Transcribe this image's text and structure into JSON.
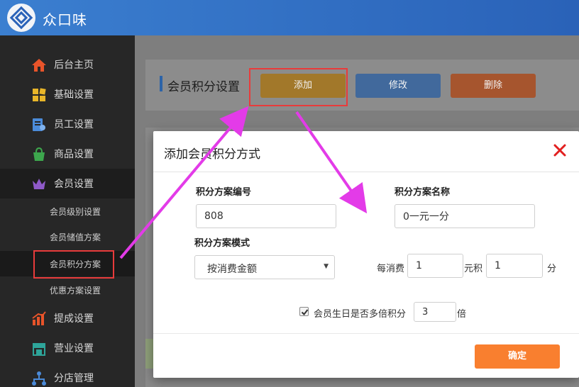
{
  "app": {
    "brand": "众口味"
  },
  "sidebar": {
    "items": [
      {
        "label": "后台主页",
        "icon": "home-icon",
        "color": "#e8542a"
      },
      {
        "label": "基础设置",
        "icon": "grid-icon",
        "color": "#e9b629"
      },
      {
        "label": "员工设置",
        "icon": "staff-icon",
        "color": "#4b8bd9"
      },
      {
        "label": "商品设置",
        "icon": "bag-icon",
        "color": "#3da64d"
      },
      {
        "label": "会员设置",
        "icon": "crown-icon",
        "color": "#8f5ac9"
      }
    ],
    "sub_items": [
      {
        "label": "会员级别设置"
      },
      {
        "label": "会员储值方案"
      },
      {
        "label": "会员积分方案"
      },
      {
        "label": "优惠方案设置"
      }
    ],
    "bottom_items": [
      {
        "label": "提成设置",
        "icon": "chart-icon",
        "color": "#e8542a"
      },
      {
        "label": "营业设置",
        "icon": "store-icon",
        "color": "#2ea59a"
      },
      {
        "label": "分店管理",
        "icon": "branch-icon",
        "color": "#4b8bd9"
      }
    ]
  },
  "page": {
    "title": "会员积分设置",
    "buttons": {
      "add": "添加",
      "edit": "修改",
      "delete": "删除"
    }
  },
  "modal": {
    "title": "添加会员积分方式",
    "scheme_no_label": "积分方案编号",
    "scheme_no_value": "808",
    "scheme_name_label": "积分方案名称",
    "scheme_name_value": "0一元一分",
    "mode_label": "积分方案模式",
    "mode_value": "按消费金额",
    "per_spend_label": "每消费",
    "per_spend_value": "1",
    "yuan_label": "元积",
    "points_value": "1",
    "points_unit": "分",
    "birthday_label": "会员生日是否多倍积分",
    "birthday_checked": true,
    "multiplier_value": "3",
    "multiplier_unit": "倍",
    "confirm_label": "确定"
  },
  "colors": {
    "accent_blue": "#2a62b8",
    "confirm_orange": "#f97f2f",
    "highlight_red": "#e83b3b",
    "arrow_magenta": "#e33be8"
  }
}
